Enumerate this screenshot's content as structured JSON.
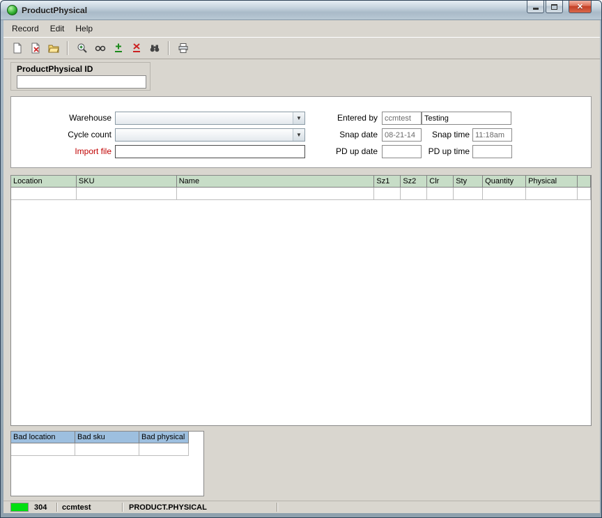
{
  "window": {
    "title": "ProductPhysical"
  },
  "menu": {
    "items": [
      "Record",
      "Edit",
      "Help"
    ]
  },
  "toolbar": {
    "icons": [
      "new-record",
      "delete-record",
      "open",
      "zoom",
      "view",
      "insert-row",
      "delete-row",
      "find",
      "print"
    ]
  },
  "id_group": {
    "label": "ProductPhysical ID",
    "value": ""
  },
  "form": {
    "warehouse": {
      "label": "Warehouse",
      "value": ""
    },
    "cycle_count": {
      "label": "Cycle count",
      "value": ""
    },
    "import_file": {
      "label": "Import file",
      "value": ""
    },
    "entered_by": {
      "label": "Entered by",
      "user": "ccmtest",
      "name": "Testing"
    },
    "snap_date": {
      "label": "Snap date",
      "value": "08-21-14"
    },
    "snap_time": {
      "label": "Snap time",
      "value": "11:18am"
    },
    "pd_up_date": {
      "label": "PD up date",
      "value": ""
    },
    "pd_up_time": {
      "label": "PD up time",
      "value": ""
    }
  },
  "main_table": {
    "columns": [
      "Location",
      "SKU",
      "Name",
      "Sz1",
      "Sz2",
      "Clr",
      "Sty",
      "Quantity",
      "Physical",
      ""
    ],
    "rows": [
      [
        "",
        "",
        "",
        "",
        "",
        "",
        "",
        "",
        "",
        ""
      ]
    ]
  },
  "bad_table": {
    "columns": [
      "Bad location",
      "Bad sku",
      "Bad physical"
    ],
    "rows": [
      [
        "",
        "",
        ""
      ]
    ]
  },
  "status_bar": {
    "code": "304",
    "user": "ccmtest",
    "record": "PRODUCT.PHYSICAL",
    "indicator_color": "#00df10"
  },
  "colors": {
    "main_header_bg": "#c7ddc7",
    "bad_header_bg": "#9dbfdf",
    "import_label": "#c00000"
  }
}
